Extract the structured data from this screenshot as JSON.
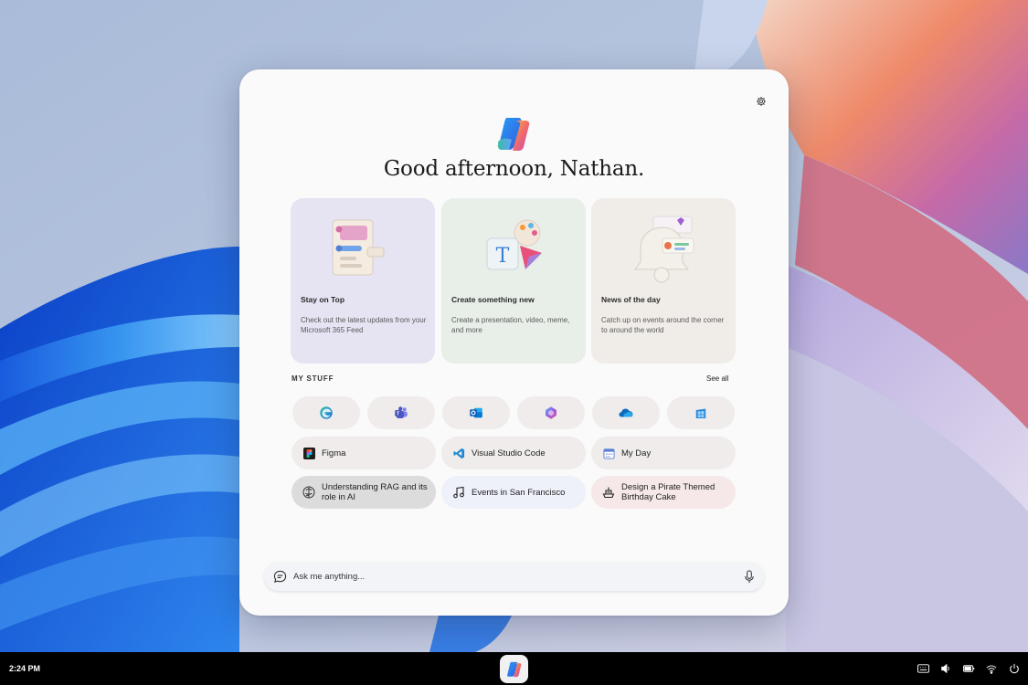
{
  "colors": {
    "accent": "#0078d4",
    "card_stay_on_top": "#e6e3f3",
    "card_create": "#e8efe9",
    "card_news": "#f0ede8",
    "chip_understanding": "#dcdcdc",
    "chip_events": "#eef0fa",
    "chip_design": "#f6e8e8",
    "chip_default": "#efeceb"
  },
  "header": {
    "greeting": "Good afternoon, Nathan.",
    "settings_icon": "gear-icon",
    "logo_icon": "copilot-logo-icon"
  },
  "cards": [
    {
      "title": "Stay on Top",
      "description": "Check out the latest updates from your Microsoft 365 Feed",
      "icon": "feed-illustration"
    },
    {
      "title": "Create something new",
      "description": "Create a presentation, video, meme, and more",
      "icon": "create-illustration"
    },
    {
      "title": "News of the day",
      "description": "Catch up on events around the corner to around the world",
      "icon": "news-illustration"
    }
  ],
  "my_stuff": {
    "label": "MY STUFF",
    "see_all": "See all",
    "apps": [
      {
        "icon": "edge-icon"
      },
      {
        "icon": "teams-icon"
      },
      {
        "icon": "outlook-icon"
      },
      {
        "icon": "copilot-icon"
      },
      {
        "icon": "onedrive-icon"
      },
      {
        "icon": "store-icon"
      }
    ],
    "chips": [
      {
        "label": "Figma",
        "icon": "figma-icon"
      },
      {
        "label": "Visual Studio Code",
        "icon": "vscode-icon"
      },
      {
        "label": "My Day",
        "icon": "calendar-icon"
      },
      {
        "label": "Understanding RAG and its role in AI",
        "icon": "brain-icon"
      },
      {
        "label": "Events in San Francisco",
        "icon": "music-note-icon"
      },
      {
        "label": "Design a Pirate Themed Birthday Cake",
        "icon": "ship-icon"
      }
    ]
  },
  "ask": {
    "placeholder": "Ask me anything...",
    "left_icon": "chat-icon",
    "right_icon": "microphone-icon"
  },
  "taskbar": {
    "time": "2:24 PM",
    "tray": [
      "keyboard-icon",
      "volume-icon",
      "battery-icon",
      "wifi-icon",
      "power-icon"
    ]
  }
}
